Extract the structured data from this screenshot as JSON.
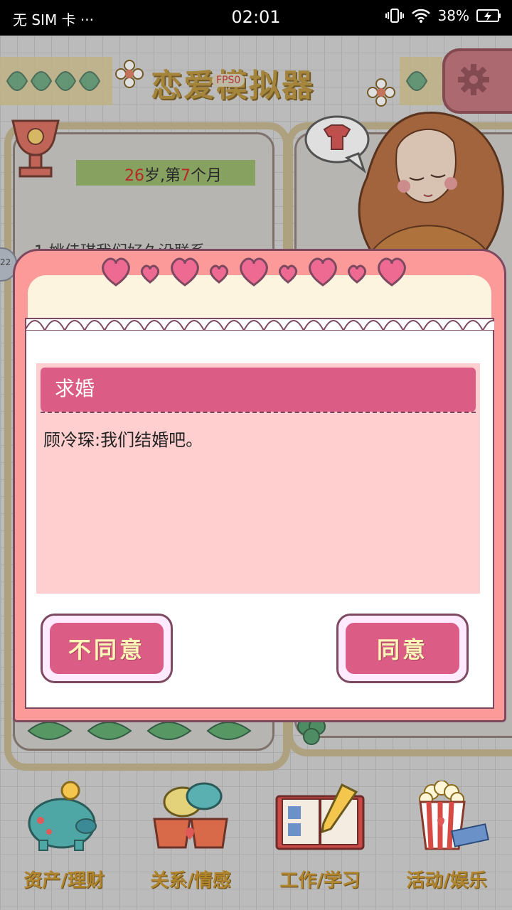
{
  "status_bar": {
    "carrier": "无 SIM 卡 ···",
    "time": "02:01",
    "battery": "38%"
  },
  "header": {
    "title": "恋爱模拟器",
    "fps_badge": "FPS0"
  },
  "left_panel": {
    "age_number": "26",
    "age_unit": "岁,第",
    "month_number": "7",
    "month_unit": "个月",
    "note_text": "1.姚佳琪我们好久没联系"
  },
  "side_tab_label": "22",
  "dialog": {
    "title": "求婚",
    "message": "顾冷琛:我们结婚吧。",
    "decline_label": "不同意",
    "accept_label": "同意"
  },
  "bottom_nav": {
    "items": [
      {
        "label": "资产/理财",
        "icon": "piggy-bank-icon"
      },
      {
        "label": "关系/情感",
        "icon": "coffee-cups-chat-icon"
      },
      {
        "label": "工作/学习",
        "icon": "notebook-pen-icon"
      },
      {
        "label": "活动/娱乐",
        "icon": "popcorn-tickets-icon"
      }
    ]
  },
  "colors": {
    "dialog_frame": "#fb9a98",
    "dialog_header": "#db5d85",
    "content_bg": "#ffcfd0",
    "button_text": "#fff6b8",
    "title_gold": "#b89238"
  }
}
